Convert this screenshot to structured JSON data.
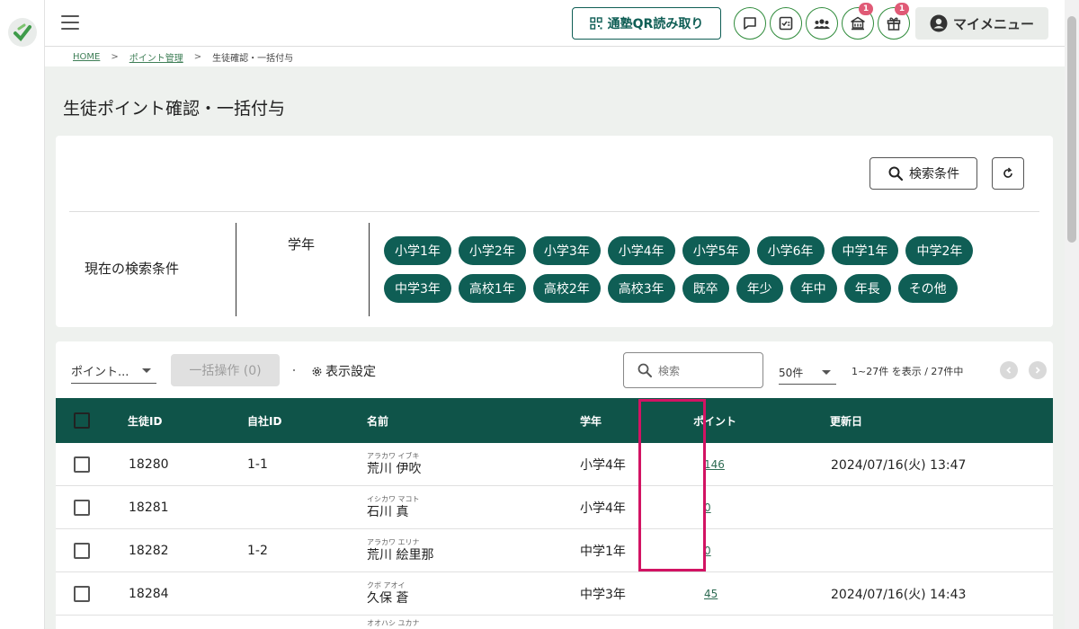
{
  "header": {
    "qr_button_label": "通塾QR読み取り",
    "icons": [
      {
        "name": "message-icon",
        "badge": ""
      },
      {
        "name": "checklist-icon",
        "badge": ""
      },
      {
        "name": "group-icon",
        "badge": ""
      },
      {
        "name": "school-icon",
        "badge": "1"
      },
      {
        "name": "gift-icon",
        "badge": "1"
      }
    ],
    "my_menu_label": "マイメニュー"
  },
  "breadcrumb": {
    "home": "HOME",
    "sep": ">",
    "point_mgmt": "ポイント管理",
    "current": "生徒確認・一括付与"
  },
  "page_title": "生徒ポイント確認・一括付与",
  "search_panel": {
    "search_button_label": "検索条件",
    "current_conditions_label": "現在の検索条件",
    "grade_label": "学年",
    "grades": [
      "小学1年",
      "小学2年",
      "小学3年",
      "小学4年",
      "小学5年",
      "小学6年",
      "中学1年",
      "中学2年",
      "中学3年",
      "高校1年",
      "高校2年",
      "高校3年",
      "既卒",
      "年少",
      "年中",
      "年長",
      "その他"
    ]
  },
  "toolbar": {
    "sort_select": "ポイント...",
    "bulk_button": "一括操作 (0)",
    "display_settings": "表示設定",
    "search_placeholder": "検索",
    "per_page": "50件",
    "range_text": "1~27件 を表示 / 27件中"
  },
  "table": {
    "headers": {
      "student_id": "生徒ID",
      "company_id": "自社ID",
      "name": "名前",
      "grade": "学年",
      "points": "ポイント",
      "updated": "更新日"
    },
    "rows": [
      {
        "student_id": "18280",
        "company_id": "1-1",
        "kana": "アラカワ イブキ",
        "name": "荒川 伊吹",
        "grade": "小学4年",
        "points": "146",
        "updated": "2024/07/16(火) 13:47"
      },
      {
        "student_id": "18281",
        "company_id": "",
        "kana": "イシカワ マコト",
        "name": "石川 真",
        "grade": "小学4年",
        "points": "0",
        "updated": ""
      },
      {
        "student_id": "18282",
        "company_id": "1-2",
        "kana": "アラカワ エリナ",
        "name": "荒川 絵里那",
        "grade": "中学1年",
        "points": "0",
        "updated": ""
      },
      {
        "student_id": "18284",
        "company_id": "",
        "kana": "クボ アオイ",
        "name": "久保 蒼",
        "grade": "中学3年",
        "points": "45",
        "updated": "2024/07/16(火) 14:43"
      },
      {
        "student_id": "",
        "company_id": "",
        "kana": "オオハシ ユカナ",
        "name": "",
        "grade": "",
        "points": "",
        "updated": ""
      }
    ]
  },
  "colors": {
    "primary": "#0f5e55",
    "table_header": "#0f5449",
    "highlight": "#d21363",
    "badge": "#e05a76"
  }
}
